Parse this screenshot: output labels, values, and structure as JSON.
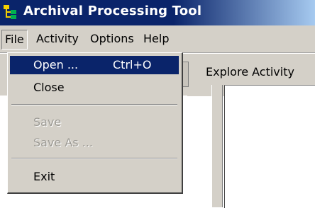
{
  "window": {
    "title": "Archival Processing Tool"
  },
  "menubar": {
    "file": "File",
    "activity": "Activity",
    "options": "Options",
    "help": "Help"
  },
  "toolbar": {
    "explore_label": "Explore Activity"
  },
  "file_menu": {
    "open": {
      "label": "Open ...",
      "shortcut": "Ctrl+O"
    },
    "close": "Close",
    "save": "Save",
    "save_as": "Save As ...",
    "exit": "Exit"
  },
  "icons": {
    "app": "app-tree-icon"
  },
  "colors": {
    "titlebar": "#0a246a",
    "highlight": "#0a246a",
    "face": "#d4d0c8"
  }
}
